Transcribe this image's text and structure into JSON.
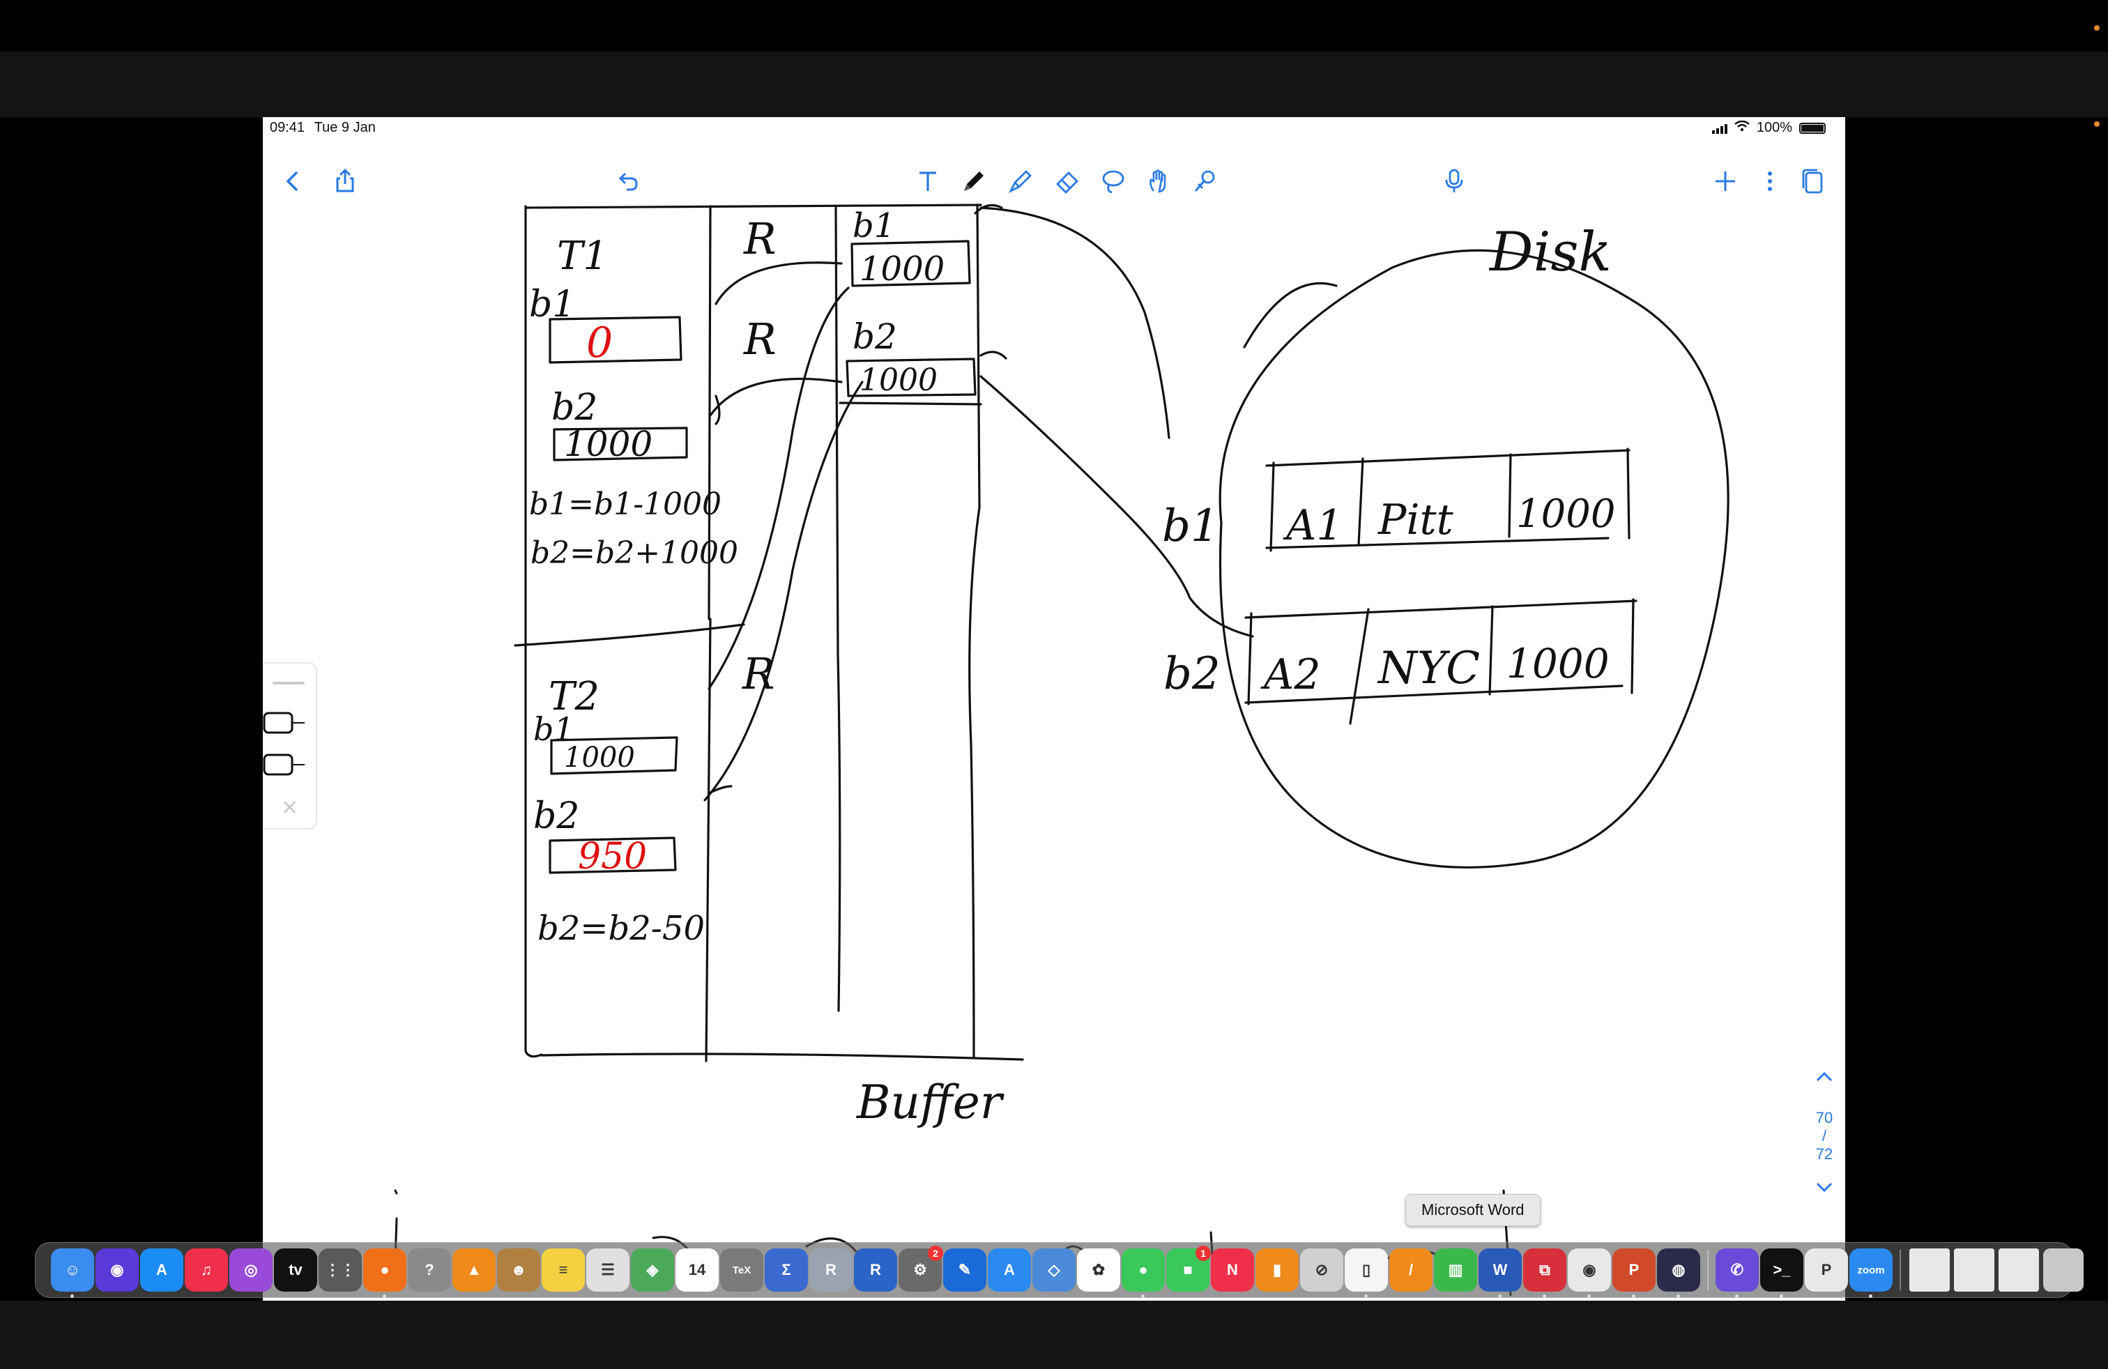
{
  "screen": {
    "accent_color": "#2a7ae2",
    "ink_color": "#111111",
    "red_ink_color": "#dd1111"
  },
  "status_bar": {
    "time": "09:41",
    "date": "Tue 9 Jan",
    "battery": "100%"
  },
  "toolbar": {
    "left": [
      "chevron-left-icon",
      "share-icon",
      "undo-icon"
    ],
    "tools": [
      "text-tool-icon",
      "pen-tool-icon",
      "highlighter-tool-icon",
      "eraser-tool-icon",
      "lasso-tool-icon",
      "hand-tool-icon",
      "laser-pointer-icon"
    ],
    "right": [
      "microphone-icon",
      "plus-icon",
      "more-icon",
      "pages-icon"
    ]
  },
  "note": {
    "t1_label": "T1",
    "t1_b1_label": "b1",
    "t1_b1_value": "0",
    "t1_b2_label": "b2",
    "t1_b2_value": "1000",
    "t1_formula1": "b1=b1-1000",
    "t1_formula2": "b2=b2+1000",
    "t2_label": "T2",
    "t2_b1_label": "b1",
    "t2_b1_value": "1000",
    "t2_b2_label": "b2",
    "t2_b2_value": "950",
    "t2_formula": "b2=b2-50",
    "r_labels": [
      "R",
      "R",
      "R"
    ],
    "buffer_b1_label": "b1",
    "buffer_b1_value": "1000",
    "buffer_b2_label": "b2",
    "buffer_b2_value": "1000",
    "buffer_caption": "Buffer",
    "disk_caption": "Disk",
    "disk_row1": [
      "b1",
      "A1",
      "Pitt",
      "1000"
    ],
    "disk_row2": [
      "b2",
      "A2",
      "NYC",
      "1000"
    ]
  },
  "page_nav": {
    "current": "70",
    "separator": "/",
    "total": "72"
  },
  "tooltip": {
    "text": "Microsoft Word"
  },
  "dock": {
    "icons": [
      {
        "name": "finder-icon",
        "glyph": "☺",
        "color": "#3b8cf0"
      },
      {
        "name": "siri-icon",
        "glyph": "◉",
        "color": "#5a3ad8"
      },
      {
        "name": "app-store-icon",
        "glyph": "A",
        "color": "#1c8cf5"
      },
      {
        "name": "music-icon",
        "glyph": "♫",
        "color": "#f0304a"
      },
      {
        "name": "podcasts-icon",
        "glyph": "◎",
        "color": "#9a4ad8"
      },
      {
        "name": "apple-tv-icon",
        "glyph": "tv",
        "color": "#111111"
      },
      {
        "name": "launchpad-icon",
        "glyph": "⋮⋮",
        "color": "#5a5a5a"
      },
      {
        "name": "firefox-icon",
        "glyph": "●",
        "color": "#f0701a"
      },
      {
        "name": "help-icon",
        "glyph": "?",
        "color": "#8a8a8a"
      },
      {
        "name": "vlc-icon",
        "glyph": "▲",
        "color": "#f08a1a"
      },
      {
        "name": "contacts-icon",
        "glyph": "☻",
        "color": "#b08040"
      },
      {
        "name": "notes-icon",
        "glyph": "≡",
        "color": "#f5d040"
      },
      {
        "name": "reminders-icon",
        "glyph": "☰",
        "color": "#e0e0e0"
      },
      {
        "name": "maps-icon",
        "glyph": "◈",
        "color": "#4aaa5a"
      },
      {
        "name": "calendar-icon",
        "glyph": "14",
        "color": "#ffffff"
      },
      {
        "name": "tex-icon",
        "glyph": "TeX",
        "color": "#7a7a7a"
      },
      {
        "name": "sigma-icon",
        "glyph": "Σ",
        "color": "#3a6ad0"
      },
      {
        "name": "r-studio-icon",
        "glyph": "R",
        "color": "#9aa4b0"
      },
      {
        "name": "r-icon",
        "glyph": "R",
        "color": "#2a64c8"
      },
      {
        "name": "system-settings-icon",
        "glyph": "⚙",
        "color": "#6a6a6a"
      },
      {
        "name": "xcode-icon",
        "glyph": "✎",
        "color": "#1a6ad8"
      },
      {
        "name": "instruments-icon",
        "glyph": "A",
        "color": "#2a8af0"
      },
      {
        "name": "cube-icon",
        "glyph": "◇",
        "color": "#4a8ad8"
      },
      {
        "name": "photos-icon",
        "glyph": "✿",
        "color": "#ffffff"
      },
      {
        "name": "messages-icon",
        "glyph": "●",
        "color": "#3ac85a"
      },
      {
        "name": "facetime-icon",
        "glyph": "■",
        "color": "#3ac85a"
      },
      {
        "name": "news-icon",
        "glyph": "N",
        "color": "#f0304a"
      },
      {
        "name": "books-icon",
        "glyph": "▮",
        "color": "#f08a1a"
      },
      {
        "name": "disk-utility-icon",
        "glyph": "⊘",
        "color": "#d0d0d0"
      },
      {
        "name": "textedit-icon",
        "glyph": "▯",
        "color": "#f5f5f5"
      },
      {
        "name": "pages-app-icon",
        "glyph": "/",
        "color": "#f08a1a"
      },
      {
        "name": "numbers-icon",
        "glyph": "▥",
        "color": "#3ab84a"
      },
      {
        "name": "microsoft-word-icon",
        "glyph": "W",
        "color": "#2a5ab8"
      },
      {
        "name": "parallels-icon",
        "glyph": "⧉",
        "color": "#d8303a"
      },
      {
        "name": "chrome-icon",
        "glyph": "◉",
        "color": "#e8e8e8"
      },
      {
        "name": "powerpoint-icon",
        "glyph": "P",
        "color": "#d04a2a"
      },
      {
        "name": "quicktime-icon",
        "glyph": "◍",
        "color": "#2a2a4a"
      },
      {
        "name": "viber-icon",
        "glyph": "✆",
        "color": "#6a4ad8"
      },
      {
        "name": "terminal-icon",
        "glyph": ">_",
        "color": "#111111"
      },
      {
        "name": "powerpoint-doc-icon",
        "glyph": "P",
        "color": "#e8e8e8"
      },
      {
        "name": "zoom-icon",
        "glyph": "zoom",
        "color": "#2a8af0"
      }
    ],
    "recent": [
      {
        "name": "window-thumbnail-1",
        "color": "#e8e8e8"
      },
      {
        "name": "window-thumbnail-2",
        "color": "#e8e8e8"
      },
      {
        "name": "window-thumbnail-3",
        "color": "#e8e8e8"
      },
      {
        "name": "trash-icon",
        "color": "#c8c8c8"
      }
    ]
  }
}
